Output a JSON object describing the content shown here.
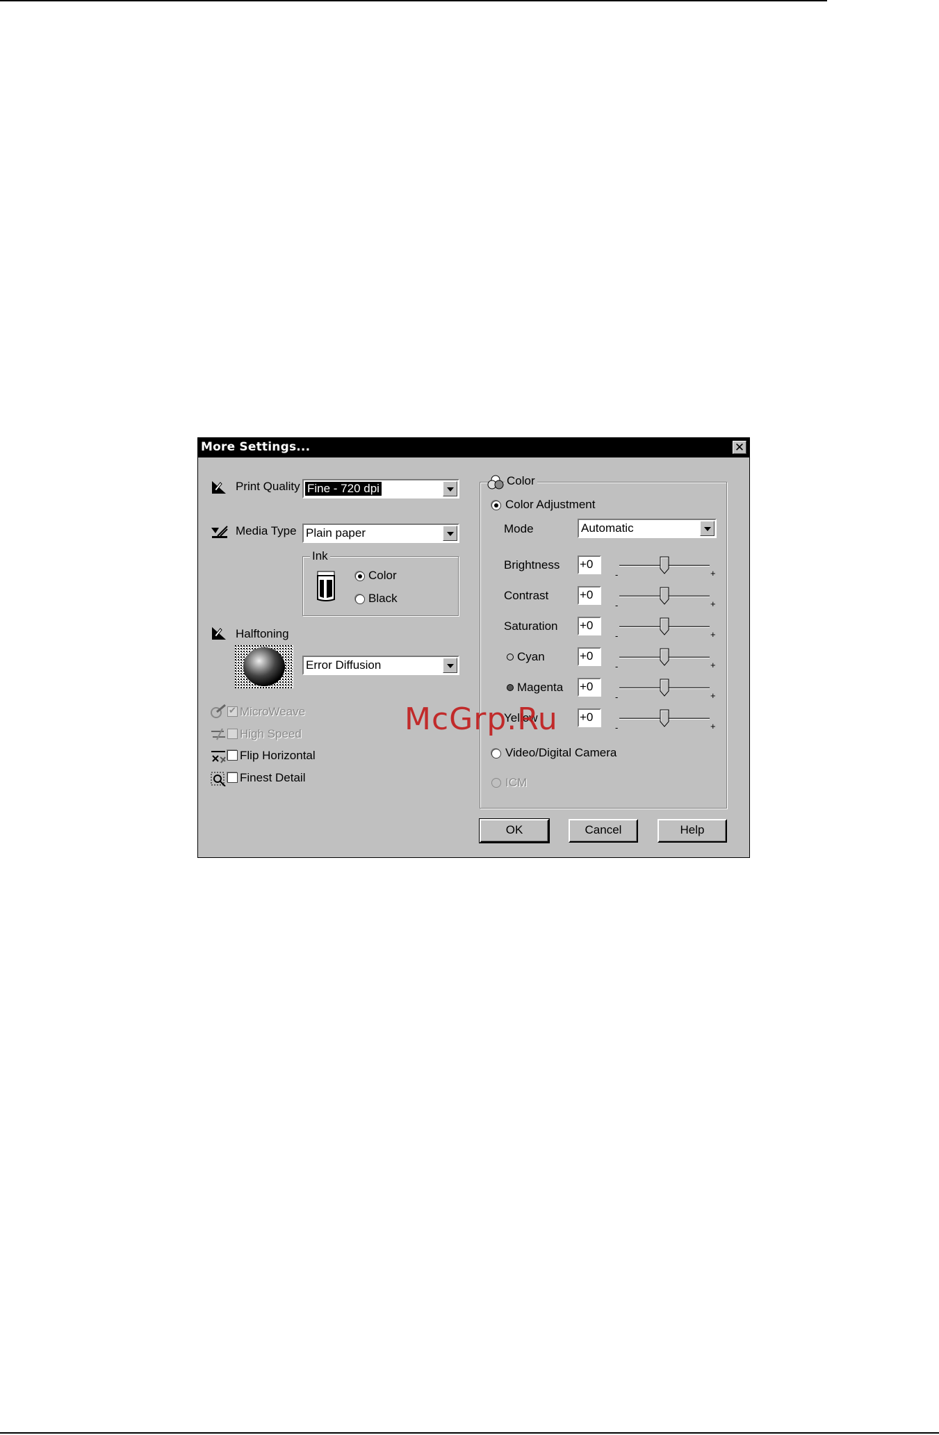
{
  "dialog": {
    "title": "More Settings...",
    "close_glyph": "✕",
    "print_quality": {
      "label": "Print Quality",
      "value": "Fine - 720 dpi"
    },
    "media_type": {
      "label": "Media Type",
      "value": "Plain paper"
    },
    "ink": {
      "label": "Ink",
      "color_label": "Color",
      "black_label": "Black",
      "selected": "Color"
    },
    "halftoning": {
      "label": "Halftoning",
      "value": "Error Diffusion"
    },
    "options": {
      "microweave": {
        "label": "MicroWeave",
        "checked": true,
        "enabled": false
      },
      "high_speed": {
        "label": "High Speed",
        "checked": false,
        "enabled": false
      },
      "flip_horizontal": {
        "label": "Flip Horizontal",
        "checked": false,
        "enabled": true
      },
      "finest_detail": {
        "label": "Finest Detail",
        "checked": false,
        "enabled": true
      }
    },
    "color_group": {
      "label": "Color",
      "color_adjustment_label": "Color Adjustment",
      "mode_label": "Mode",
      "mode_value": "Automatic",
      "sliders": [
        {
          "label": "Brightness",
          "value": "+0",
          "min_label": "-",
          "max_label": "+"
        },
        {
          "label": "Contrast",
          "value": "+0",
          "min_label": "-",
          "max_label": "+"
        },
        {
          "label": "Saturation",
          "value": "+0",
          "min_label": "-",
          "max_label": "+"
        },
        {
          "label": "Cyan",
          "value": "+0",
          "min_label": "-",
          "max_label": "+"
        },
        {
          "label": "Magenta",
          "value": "+0",
          "min_label": "-",
          "max_label": "+"
        },
        {
          "label": "Yellow",
          "value": "+0",
          "min_label": "-",
          "max_label": "+"
        }
      ],
      "video_label": "Video/Digital Camera",
      "icm_label": "ICM"
    },
    "buttons": {
      "ok": "OK",
      "cancel": "Cancel",
      "help": "Help"
    }
  },
  "watermark": "McGrp.Ru",
  "colors": {
    "dialog_bg": "#c0c0c0",
    "titlebar": "#000000",
    "watermark": "#c21a1a"
  },
  "icons": [
    "print-quality-icon",
    "media-type-icon",
    "ink-bottle-icon",
    "halftoning-icon",
    "halftone-preview-icon",
    "microweave-icon",
    "high-speed-icon",
    "flip-horizontal-icon",
    "finest-detail-icon",
    "color-circles-icon"
  ]
}
